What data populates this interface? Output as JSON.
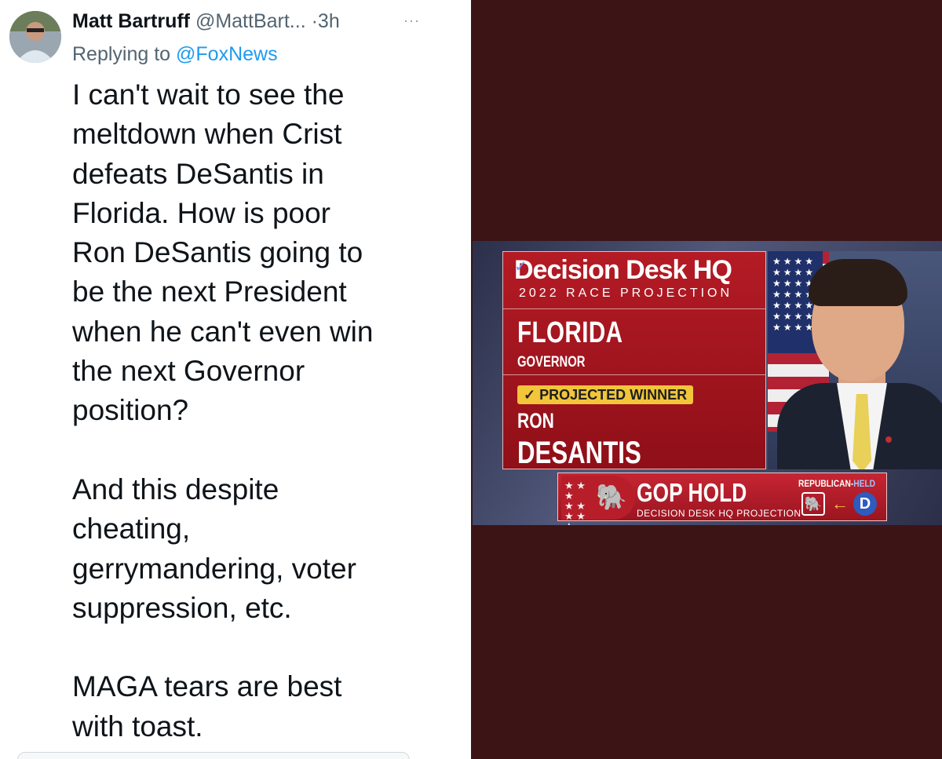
{
  "tweet": {
    "display_name": "Matt Bartruff",
    "handle": "@MattBart...",
    "separator": "·",
    "time": "3h",
    "more_icon": "···",
    "reply_prefix": "Replying to",
    "reply_to": "@FoxNews",
    "text": "I can't wait to see the\nmeltdown when Crist\ndefeats DeSantis in\nFlorida. How is poor\nRon DeSantis going to\nbe the next President\nwhen he can't even win\nthe next Governor\nposition?\n\nAnd this despite\ncheating,\ngerrymandering, voter\nsuppression, etc.\n\nMAGA tears are best\nwith toast."
  },
  "graphic": {
    "brand": "Decision Desk HQ",
    "race_label": "2022 RACE PROJECTION",
    "state": "FLORIDA",
    "office": "GOVERNOR",
    "winner_badge": "✓ PROJECTED WINNER",
    "first_name": "RON",
    "last_name": "DESANTIS",
    "gop_hold": "GOP HOLD",
    "gop_sub": "DECISION DESK HQ PROJECTION",
    "rep_held_prefix": "REPUBLICAN-",
    "rep_held_suffix": "HELD",
    "dem_letter": "D"
  },
  "colors": {
    "panel_bg": "#3c1416",
    "card_red": "#b41b25",
    "badge_yellow": "#f2c53a",
    "link_blue": "#1d9bf0"
  }
}
